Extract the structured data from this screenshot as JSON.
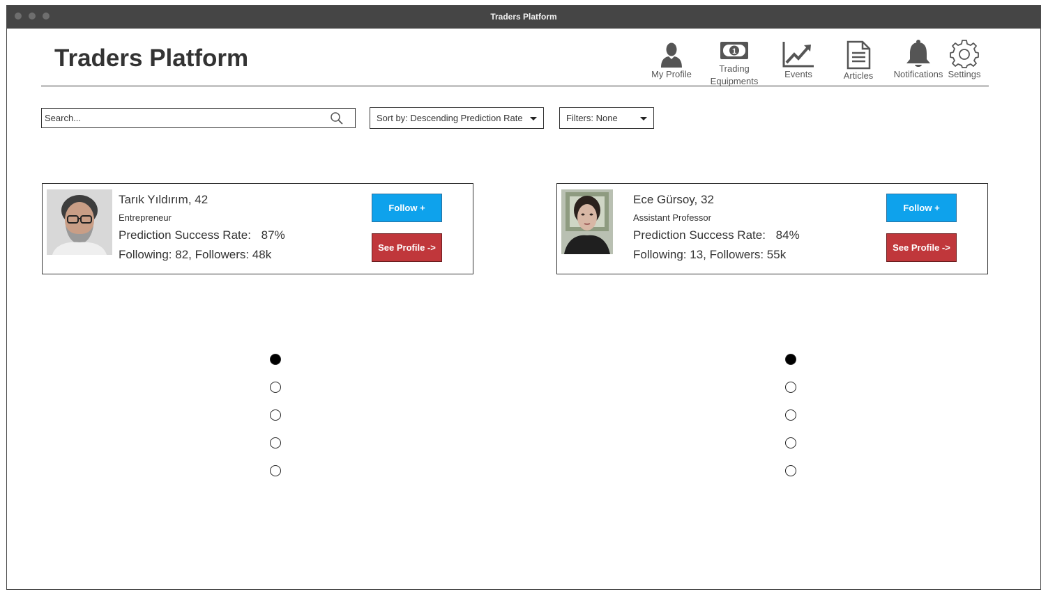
{
  "window": {
    "title": "Traders Platform"
  },
  "app": {
    "title": "Traders Platform"
  },
  "nav": [
    {
      "label": "My Profile",
      "icon": "user-icon"
    },
    {
      "label": "Trading Equipments",
      "icon": "money-bill-icon"
    },
    {
      "label": "Events",
      "icon": "line-chart-icon"
    },
    {
      "label": "Articles",
      "icon": "document-icon"
    },
    {
      "label": "Notifications",
      "icon": "bell-icon"
    },
    {
      "label": "Settings",
      "icon": "gear-icon"
    }
  ],
  "search": {
    "placeholder": "Search...",
    "value": ""
  },
  "sort": {
    "label": "Sort by: Descending Prediction Rate"
  },
  "filters": {
    "label": "Filters: None"
  },
  "traders": [
    {
      "name": "Tarık Yıldırım, 42",
      "role": "Entrepreneur",
      "rate_label": "Prediction Success Rate:",
      "rate_value": "87%",
      "follow_stats": "Following: 82, Followers: 48k",
      "follow_button": "Follow +",
      "profile_button": "See Profile ->"
    },
    {
      "name": "Ece Gürsoy, 32",
      "role": "Assistant Professor",
      "rate_label": "Prediction Success Rate:",
      "rate_value": "84%",
      "follow_stats": "Following: 13, Followers: 55k",
      "follow_button": "Follow +",
      "profile_button": "See Profile ->"
    }
  ],
  "pagination": {
    "pages": 5,
    "active_page": 1
  },
  "colors": {
    "follow": "#0ea2ec",
    "see_profile": "#c0373b",
    "titlebar": "#454545"
  }
}
